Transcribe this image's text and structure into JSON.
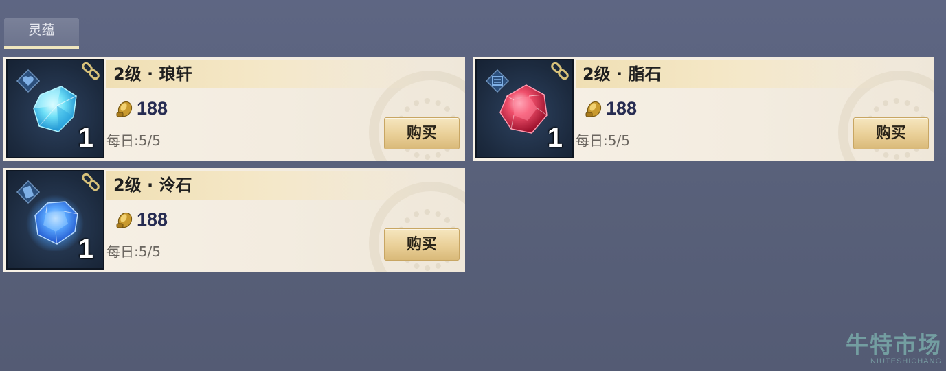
{
  "tab": {
    "label": "灵蕴"
  },
  "items": [
    {
      "title": "2级 · 琅轩",
      "price": "188",
      "quantity": "1",
      "daily": "每日:5/5",
      "button": "购买",
      "gem_color": "#5fd6f2",
      "gem_icon": "cyan-gem-icon"
    },
    {
      "title": "2级 · 脂石",
      "price": "188",
      "quantity": "1",
      "daily": "每日:5/5",
      "button": "购买",
      "gem_color": "#e8334f",
      "gem_icon": "red-gem-icon"
    },
    {
      "title": "2级 · 泠石",
      "price": "188",
      "quantity": "1",
      "daily": "每日:5/5",
      "button": "购买",
      "gem_color": "#3b8df5",
      "gem_icon": "blue-gem-icon"
    }
  ],
  "watermark": {
    "cn": "牛特市场",
    "en": "NIUTESHICHANG"
  },
  "colors": {
    "background": "#5a627c",
    "card": "#f5efe3",
    "title_bar": "#f0dfb4",
    "price_text": "#272c52",
    "button": "#e9cf97"
  }
}
